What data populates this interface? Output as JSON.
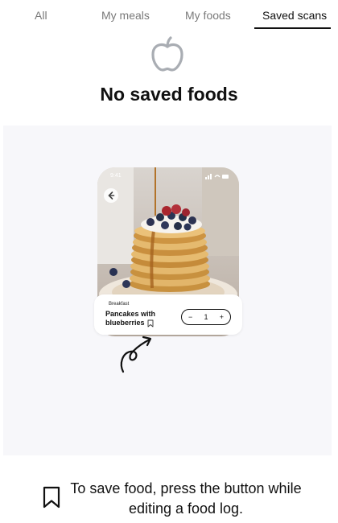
{
  "tabs": [
    {
      "label": "All",
      "active": false
    },
    {
      "label": "My meals",
      "active": false
    },
    {
      "label": "My foods",
      "active": false
    },
    {
      "label": "Saved scans",
      "active": true
    }
  ],
  "empty_state": {
    "icon": "apple-icon",
    "title": "No saved foods"
  },
  "illustration": {
    "phone_status_time": "9:41",
    "meal_type": "Breakfast",
    "food_name": "Pancakes with blueberries",
    "quantity": "1",
    "decrement_label": "−",
    "increment_label": "+"
  },
  "hint": {
    "icon": "bookmark-icon",
    "text": "To save food, press the button while editing a food log."
  },
  "colors": {
    "accent": "#111111",
    "inactive_tab": "#7a7a7a",
    "panel_bg": "#f7f7fa"
  }
}
